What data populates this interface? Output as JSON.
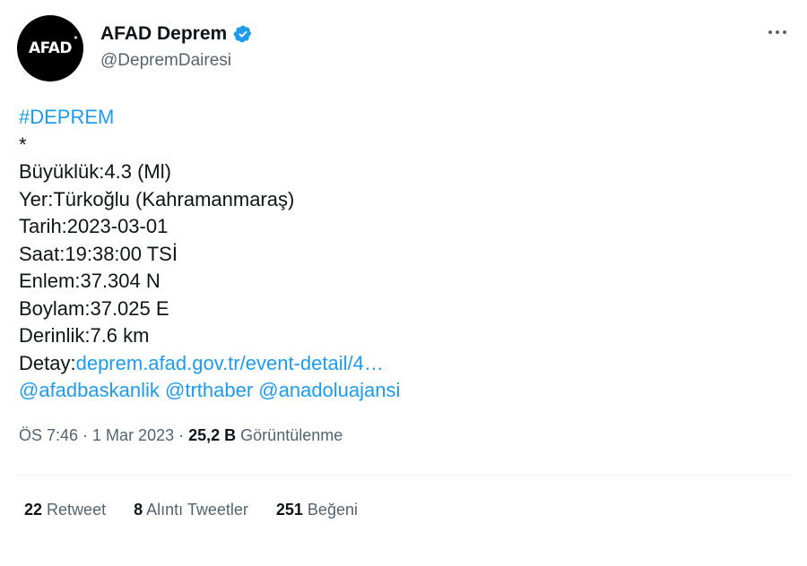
{
  "author": {
    "avatar_text": "AFAD",
    "avatar_mark": "*",
    "display_name": "AFAD Deprem",
    "handle": "@DepremDairesi",
    "verified": true
  },
  "tweet": {
    "hashtag": "#DEPREM",
    "star_line": "*",
    "magnitude": "Büyüklük:4.3 (Ml)",
    "location": "Yer:Türkoğlu (Kahramanmaraş)",
    "date": "Tarih:2023-03-01",
    "time": "Saat:19:38:00 TSİ",
    "latitude": "Enlem:37.304 N",
    "longitude": "Boylam:37.025 E",
    "depth": "Derinlik:7.6 km",
    "detail_label": "Detay:",
    "detail_link": "deprem.afad.gov.tr/event-detail/4…",
    "mentions": [
      "@afadbaskanlik",
      "@trthaber",
      "@anadoluajansi"
    ]
  },
  "meta": {
    "time": "ÖS 7:46",
    "separator": " · ",
    "date": "1 Mar 2023",
    "views_count": "25,2 B",
    "views_label": "Görüntülenme"
  },
  "stats": {
    "retweets_count": "22",
    "retweets_label": "Retweet",
    "quotes_count": "8",
    "quotes_label": "Alıntı Tweetler",
    "likes_count": "251",
    "likes_label": "Beğeni"
  },
  "colors": {
    "link": "#1d9bf0",
    "secondary_text": "#536471",
    "primary_text": "#0f1419",
    "verified_badge": "#1d9bf0"
  },
  "icons": {
    "verified": "verified-badge-icon",
    "more": "more-options-icon"
  }
}
